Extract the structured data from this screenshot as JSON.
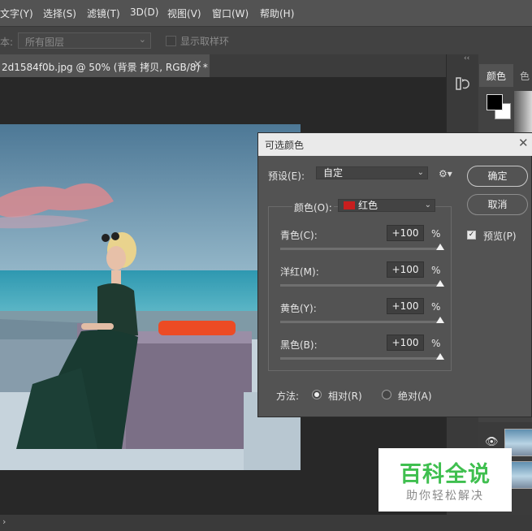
{
  "menu": [
    "文字(Y)",
    "选择(S)",
    "滤镜(T)",
    "3D(D)",
    "视图(V)",
    "窗口(W)",
    "帮助(H)"
  ],
  "options_bar": {
    "sample_label": "本:",
    "sample_value": "所有图层",
    "show_ring_label": "显示取样环"
  },
  "document_tab": {
    "label": "2d1584f0b.jpg @ 50% (背景 拷贝, RGB/8) *",
    "close": "×"
  },
  "panel": {
    "tab_color": "颜色",
    "tab_more": "色",
    "collapse": "‹‹"
  },
  "dialog": {
    "title": "可选颜色",
    "preset_label": "预设(E):",
    "preset_value": "自定",
    "colors_label": "颜色(O):",
    "colors_value": "红色",
    "colors_swatch": "#c81e1e",
    "ok": "确定",
    "cancel": "取消",
    "preview_label": "预览(P)",
    "preview_checked": true,
    "sliders": [
      {
        "label": "青色(C):",
        "value": "+100",
        "unit": "%",
        "level": 1.0
      },
      {
        "label": "洋红(M):",
        "value": "+100",
        "unit": "%",
        "level": 1.0
      },
      {
        "label": "黄色(Y):",
        "value": "+100",
        "unit": "%",
        "level": 1.0
      },
      {
        "label": "黑色(B):",
        "value": "+100",
        "unit": "%",
        "level": 1.0
      }
    ],
    "method_label": "方法:",
    "method_relative": "相对(R)",
    "method_absolute": "绝对(A)",
    "method_selected": "relative"
  },
  "status": {
    "arrow": "›"
  },
  "annotation_arrow_color": "#e8232e",
  "watermark": {
    "main": "百科全说",
    "sub": "助你轻松解决"
  }
}
